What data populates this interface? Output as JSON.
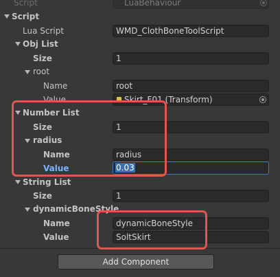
{
  "header": {
    "script_label": "Script",
    "script_value": "LuaBehaviour"
  },
  "script_section": {
    "title": "Script",
    "lua_script_label": "Lua Script",
    "lua_script_value": "WMD_ClothBoneToolScript"
  },
  "obj_list": {
    "title": "Obj List",
    "size_label": "Size",
    "size_value": "1",
    "item_title": "root",
    "name_label": "Name",
    "name_value": "root",
    "value_label": "Value",
    "value_value": "Skirt_F01 (Transform)"
  },
  "number_list": {
    "title": "Number List",
    "size_label": "Size",
    "size_value": "1",
    "item_title": "radius",
    "name_label": "Name",
    "name_value": "radius",
    "value_label": "Value",
    "value_value": "0.03"
  },
  "string_list": {
    "title": "String List",
    "size_label": "Size",
    "size_value": "1",
    "item_title": "dynamicBoneStyle",
    "name_label": "Name",
    "name_value": "dynamicBoneStyle",
    "value_label": "Value",
    "value_value": "SoltSkirt"
  },
  "footer": {
    "add_component_label": "Add Component"
  },
  "colors": {
    "highlight": "#e0574f",
    "selected_label": "#7fb1ff",
    "selected_field_border": "#3a79bb"
  }
}
